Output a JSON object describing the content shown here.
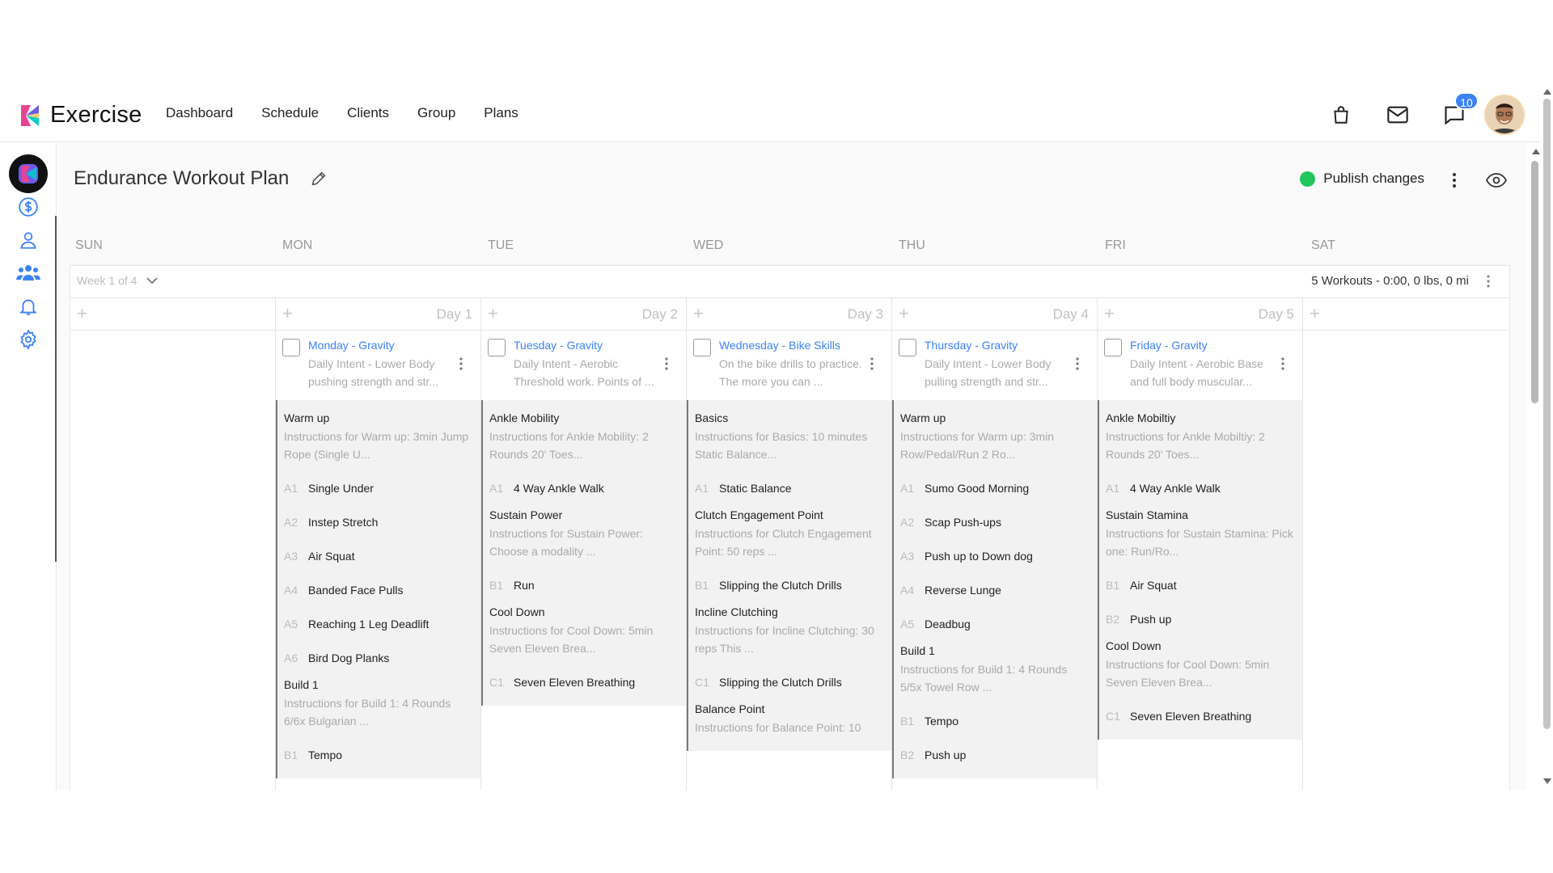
{
  "brand": {
    "name": "Exercise"
  },
  "nav": [
    "Dashboard",
    "Schedule",
    "Clients",
    "Group",
    "Plans"
  ],
  "notifications": {
    "count": "10"
  },
  "page": {
    "title": "Endurance Workout Plan",
    "publish_label": "Publish changes"
  },
  "days_of_week": [
    "SUN",
    "MON",
    "TUE",
    "WED",
    "THU",
    "FRI",
    "SAT"
  ],
  "week": {
    "label": "Week 1 of 4",
    "summary": "5 Workouts - 0:00, 0 lbs, 0 mi"
  },
  "columns": [
    {
      "day_label": ""
    },
    {
      "day_label": "Day 1",
      "workout": {
        "title": "Monday - Gravity",
        "desc": "Daily Intent - Lower Body pushing strength and str...",
        "sections": [
          {
            "title": "Warm up",
            "inst": "Instructions for Warm up: 3min Jump Rope (Single U...",
            "exercises": [
              {
                "code": "A1",
                "name": "Single Under"
              },
              {
                "code": "A2",
                "name": "Instep Stretch"
              },
              {
                "code": "A3",
                "name": "Air Squat"
              },
              {
                "code": "A4",
                "name": "Banded Face Pulls"
              },
              {
                "code": "A5",
                "name": "Reaching 1 Leg Deadlift"
              },
              {
                "code": "A6",
                "name": "Bird Dog Planks"
              }
            ]
          },
          {
            "title": "Build 1",
            "inst": "Instructions for Build 1: 4 Rounds 6/6x Bulgarian ...",
            "exercises": [
              {
                "code": "B1",
                "name": "Tempo"
              }
            ]
          }
        ]
      }
    },
    {
      "day_label": "Day 2",
      "workout": {
        "title": "Tuesday - Gravity",
        "desc": "Daily Intent - Aerobic Threshold work. Points of ...",
        "sections": [
          {
            "title": "Ankle Mobility",
            "inst": "Instructions for Ankle Mobility: 2 Rounds 20' Toes...",
            "exercises": [
              {
                "code": "A1",
                "name": "4 Way Ankle Walk"
              }
            ]
          },
          {
            "title": "Sustain Power",
            "inst": "Instructions for Sustain Power: Choose a modality ...",
            "exercises": [
              {
                "code": "B1",
                "name": "Run"
              }
            ]
          },
          {
            "title": "Cool Down",
            "inst": "Instructions for Cool Down: 5min Seven Eleven Brea...",
            "exercises": [
              {
                "code": "C1",
                "name": "Seven Eleven Breathing"
              }
            ]
          }
        ]
      }
    },
    {
      "day_label": "Day 3",
      "workout": {
        "title": "Wednesday - Bike Skills",
        "desc": "On the bike drills to practice. The more you can ...",
        "sections": [
          {
            "title": "Basics",
            "inst": "Instructions for Basics: 10 minutes Static Balance...",
            "exercises": [
              {
                "code": "A1",
                "name": "Static Balance"
              }
            ]
          },
          {
            "title": "Clutch Engagement Point",
            "inst": "Instructions for Clutch Engagement Point: 50 reps ...",
            "exercises": [
              {
                "code": "B1",
                "name": "Slipping the Clutch Drills"
              }
            ]
          },
          {
            "title": "Incline Clutching",
            "inst": "Instructions for Incline Clutching: 30 reps This ...",
            "exercises": [
              {
                "code": "C1",
                "name": "Slipping the Clutch Drills"
              }
            ]
          },
          {
            "title": "Balance Point",
            "inst": "Instructions for Balance Point: 10",
            "exercises": []
          }
        ]
      }
    },
    {
      "day_label": "Day 4",
      "workout": {
        "title": "Thursday - Gravity",
        "desc": "Daily Intent - Lower Body pulling strength and str...",
        "sections": [
          {
            "title": "Warm up",
            "inst": "Instructions for Warm up: 3min Row/Pedal/Run 2 Ro...",
            "exercises": [
              {
                "code": "A1",
                "name": "Sumo Good Morning"
              },
              {
                "code": "A2",
                "name": "Scap Push-ups"
              },
              {
                "code": "A3",
                "name": "Push up to Down dog"
              },
              {
                "code": "A4",
                "name": "Reverse Lunge"
              },
              {
                "code": "A5",
                "name": "Deadbug"
              }
            ]
          },
          {
            "title": "Build 1",
            "inst": "Instructions for Build 1: 4 Rounds 5/5x Towel Row ...",
            "exercises": [
              {
                "code": "B1",
                "name": "Tempo"
              },
              {
                "code": "B2",
                "name": "Push up"
              }
            ]
          }
        ]
      }
    },
    {
      "day_label": "Day 5",
      "workout": {
        "title": "Friday - Gravity",
        "desc": "Daily Intent - Aerobic Base and full body muscular...",
        "sections": [
          {
            "title": "Ankle Mobiltiy",
            "inst": "Instructions for Ankle Mobiltiy: 2 Rounds 20' Toes...",
            "exercises": [
              {
                "code": "A1",
                "name": "4 Way Ankle Walk"
              }
            ]
          },
          {
            "title": "Sustain Stamina",
            "inst": "Instructions for Sustain Stamina: Pick one: Run/Ro...",
            "exercises": [
              {
                "code": "B1",
                "name": "Air Squat"
              },
              {
                "code": "B2",
                "name": "Push up"
              }
            ]
          },
          {
            "title": "Cool Down",
            "inst": "Instructions for Cool Down: 5min Seven Eleven Brea...",
            "exercises": [
              {
                "code": "C1",
                "name": "Seven Eleven Breathing"
              }
            ]
          }
        ]
      }
    },
    {
      "day_label": ""
    }
  ],
  "colors": {
    "accent": "#3b82f6",
    "publish_dot": "#22c55e"
  }
}
